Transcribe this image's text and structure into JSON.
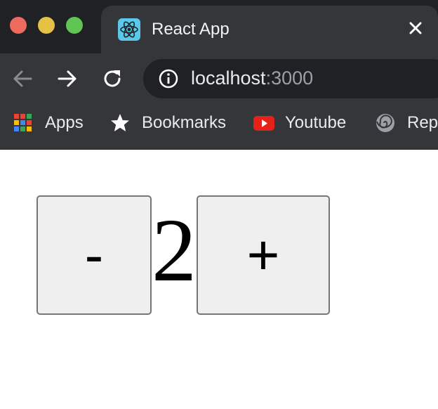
{
  "window": {
    "controls": [
      "close",
      "minimize",
      "maximize"
    ]
  },
  "tab": {
    "title": "React App",
    "favicon": "react-logo-icon",
    "close_icon": "close-icon"
  },
  "toolbar": {
    "back_icon": "arrow-left-icon",
    "forward_icon": "arrow-right-icon",
    "reload_icon": "reload-icon",
    "site_info_icon": "info-icon",
    "url_host": "localhost",
    "url_port": ":3000"
  },
  "bookmarks": [
    {
      "label": "Apps",
      "icon": "apps-grid-icon"
    },
    {
      "label": "Bookmarks",
      "icon": "star-icon"
    },
    {
      "label": "Youtube",
      "icon": "youtube-icon"
    },
    {
      "label": "Rep",
      "icon": "spiral-icon"
    }
  ],
  "counter": {
    "decrement_label": "-",
    "value": "2",
    "increment_label": "+"
  },
  "colors": {
    "chrome_dark": "#202124",
    "chrome_toolbar": "#35363a",
    "button_bg": "#efefef",
    "button_border": "#767676"
  }
}
